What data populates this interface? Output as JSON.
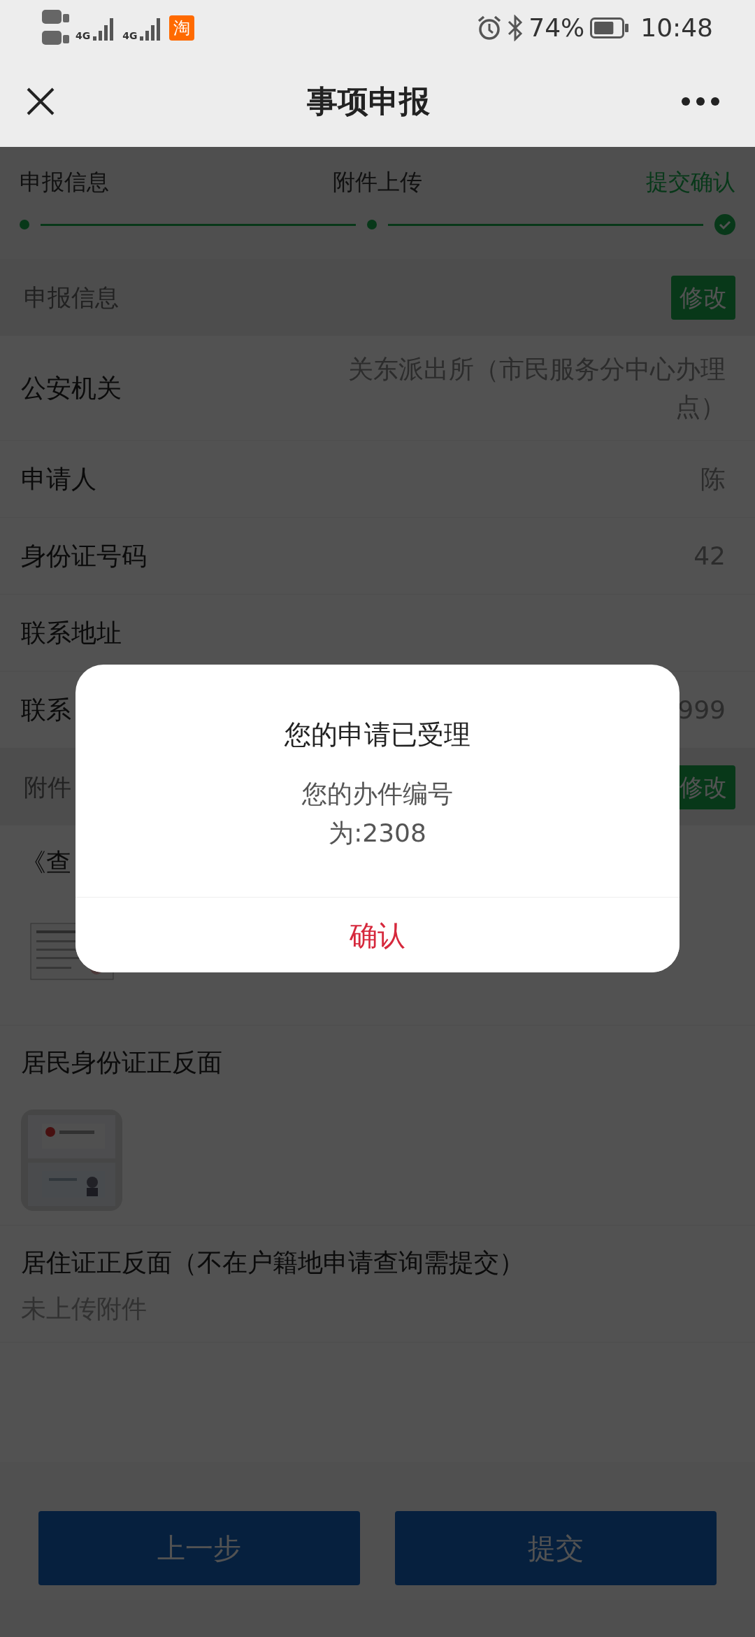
{
  "status_bar": {
    "networks": [
      "4G",
      "4G"
    ],
    "notification": "淘",
    "battery_text": "74%",
    "battery": {
      "level": 0.74
    },
    "time": "10:48"
  },
  "nav": {
    "title": "事项申报"
  },
  "steps": [
    {
      "label": "申报信息",
      "selected": false
    },
    {
      "label": "附件上传",
      "selected": false
    },
    {
      "label": "提交确认",
      "selected": true
    }
  ],
  "info_section": {
    "title": "申报信息",
    "edit": "修改",
    "rows": [
      {
        "label": "公安机关",
        "value": "关东派出所（市民服务分中心办理点）"
      },
      {
        "label": "申请人",
        "value": "陈"
      },
      {
        "label": "身份证号码",
        "value": "42"
      },
      {
        "label": "联系地址",
        "value": ""
      },
      {
        "label": "联系",
        "value": "999"
      }
    ]
  },
  "attachment_section": {
    "title": "附件",
    "edit": "修改",
    "items": [
      {
        "title": "《查",
        "kind": "document"
      },
      {
        "title": "居民身份证正反面",
        "kind": "picture"
      },
      {
        "title": "居住证正反面（不在户籍地申请查询需提交）",
        "kind": "none",
        "note": "未上传附件"
      }
    ]
  },
  "footer": {
    "buttons": [
      "上一步",
      "提交"
    ]
  },
  "dialog": {
    "title": "您的申请已受理",
    "message": "您的办件编号为:2308",
    "confirm": "确认"
  }
}
